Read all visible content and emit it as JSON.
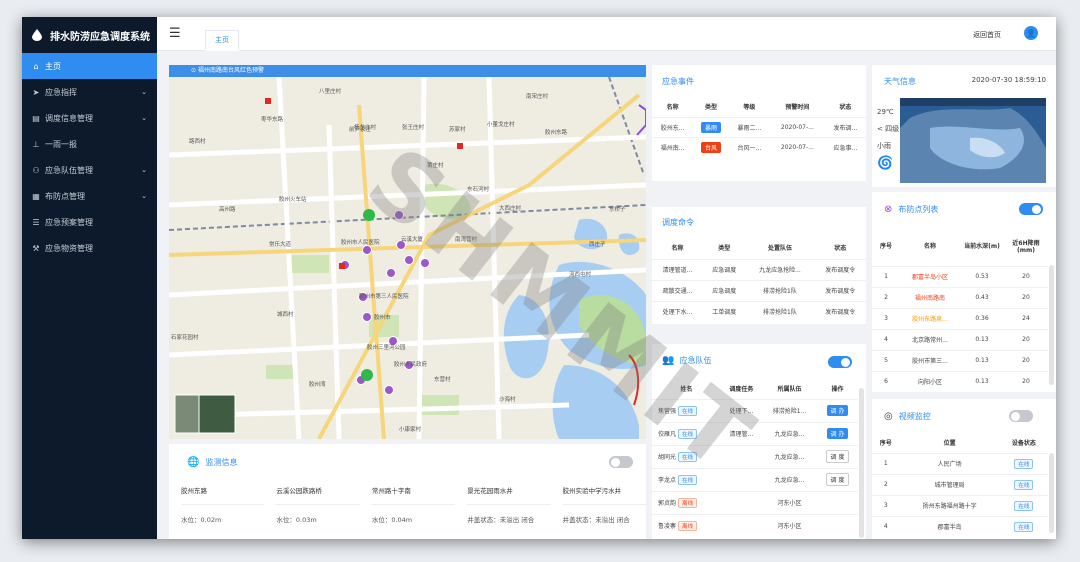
{
  "app_title": "排水防涝应急调度系统",
  "sidebar": {
    "items": [
      {
        "label": "主页",
        "icon": "home-icon",
        "active": true
      },
      {
        "label": "应急指挥",
        "icon": "send-icon",
        "expandable": true
      },
      {
        "label": "调度信息管理",
        "icon": "document-icon",
        "expandable": true
      },
      {
        "label": "一雨一报",
        "icon": "upload-icon"
      },
      {
        "label": "应急队伍管理",
        "icon": "team-icon",
        "expandable": true
      },
      {
        "label": "布防点管理",
        "icon": "grid-icon",
        "expandable": true
      },
      {
        "label": "应急预案管理",
        "icon": "list-icon"
      },
      {
        "label": "应急物资管理",
        "icon": "wrench-icon"
      }
    ]
  },
  "topbar": {
    "tab": "主页",
    "back_home": "返回首页"
  },
  "map": {
    "banner": "福州南路南台风红色预警",
    "labels": [
      "八里庄村",
      "枣华东路",
      "南宋庄村",
      "前尹家庄",
      "苏家村",
      "张王庄村",
      "小董戈庄村",
      "杨戈庄村",
      "胶州东路",
      "莆庄村",
      "东石河村",
      "胶州火车站",
      "高州路",
      "东桥子",
      "路西村",
      "大西庄村",
      "西庄子",
      "常乐大道",
      "胶州市人民医院",
      "云溪大厦",
      "南湾营村",
      "胶州市",
      "城西村",
      "胶州市第三人民医院",
      "石家花园村",
      "胶州三里河公园",
      "胶州湾",
      "小康家村",
      "胶州人民政府",
      "沙海村",
      "东营村",
      "河西屯村"
    ]
  },
  "monitor": {
    "title": "监测信息",
    "columns": [
      "胶州东路",
      "云溪公园跌路桥",
      "常州路十字南",
      "景光花园雨水井",
      "胶州实验中学污水井"
    ],
    "values": [
      "水位：0.02m",
      "水位：0.03m",
      "水位：0.04m",
      "井盖状态：未溢出 闭合",
      "井盖状态：未溢出 闭合"
    ]
  },
  "events": {
    "title": "应急事件",
    "headers": [
      "名称",
      "类型",
      "等级",
      "预警时间",
      "状态"
    ],
    "rows": [
      {
        "name": "胶州东...",
        "type": "暴雨",
        "type_color": "#2f8cf0",
        "level": "暴雨二...",
        "time": "2020-07-...",
        "status": "发布调..."
      },
      {
        "name": "福州南...",
        "type": "台风",
        "type_color": "#ed4014",
        "level": "台风一...",
        "time": "2020-07-...",
        "status": "应急事..."
      }
    ]
  },
  "commands": {
    "title": "调度命令",
    "headers": [
      "名称",
      "类型",
      "处置队伍",
      "状态"
    ],
    "rows": [
      {
        "name": "清理管道...",
        "type": "应急调度",
        "team": "九龙应急抢险...",
        "status": "发布调度令"
      },
      {
        "name": "疏散交通...",
        "type": "应急调度",
        "team": "排涝抢险1队",
        "status": "发布调度令"
      },
      {
        "name": "处理下水...",
        "type": "工单调度",
        "team": "排涝抢险1队",
        "status": "发布调度令"
      }
    ]
  },
  "teams": {
    "title": "应急队伍",
    "headers": [
      "姓名",
      "调度任务",
      "所属队伍",
      "操作"
    ],
    "rows": [
      {
        "name": "焦营强",
        "status": "在线",
        "task": "处理下...",
        "team": "排涝抢险1...",
        "action": "调 办"
      },
      {
        "name": "佼雁凡",
        "status": "在线",
        "task": "清理管...",
        "team": "九龙应急...",
        "action": "调 办"
      },
      {
        "name": "胡同光",
        "status": "在线",
        "task": "",
        "team": "九龙应急...",
        "action": "调 度"
      },
      {
        "name": "李龙点",
        "status": "在线",
        "task": "",
        "team": "九龙应急...",
        "action": "调 度"
      },
      {
        "name": "郭贞韵",
        "status": "离线",
        "task": "",
        "team": "河东小区",
        "action": ""
      },
      {
        "name": "鲁凌寨",
        "status": "离线",
        "task": "",
        "team": "河东小区",
        "action": ""
      }
    ]
  },
  "weather": {
    "title": "天气信息",
    "datetime": "2020-07-30 18:59:10",
    "temp": "29℃",
    "wind": "< 四级",
    "condition": "小雨"
  },
  "points": {
    "title": "布防点列表",
    "headers": [
      "序号",
      "名称",
      "当前水深(m)",
      "近6H降雨(mm)"
    ],
    "rows": [
      {
        "no": "1",
        "name": "郡富半岛小区",
        "depth": "0.53",
        "rain": "20",
        "color": "#ed4014"
      },
      {
        "no": "2",
        "name": "福州南路南",
        "depth": "0.43",
        "rain": "20",
        "color": "#ed4014"
      },
      {
        "no": "3",
        "name": "胶州东路泉...",
        "depth": "0.36",
        "rain": "24",
        "color": "#ff9900"
      },
      {
        "no": "4",
        "name": "北京路常州...",
        "depth": "0.13",
        "rain": "20",
        "color": "#444"
      },
      {
        "no": "5",
        "name": "胶州市第三...",
        "depth": "0.13",
        "rain": "20",
        "color": "#444"
      },
      {
        "no": "6",
        "name": "向阳小区",
        "depth": "0.13",
        "rain": "20",
        "color": "#444"
      }
    ]
  },
  "video": {
    "title": "视频监控",
    "headers": [
      "序号",
      "位置",
      "设备状态"
    ],
    "rows": [
      {
        "no": "1",
        "loc": "人民广场",
        "status": "在线"
      },
      {
        "no": "2",
        "loc": "城市管理局",
        "status": "在线"
      },
      {
        "no": "3",
        "loc": "扬州东路福州路十字",
        "status": "在线"
      },
      {
        "no": "4",
        "loc": "郡富半岛",
        "status": "在线"
      }
    ]
  },
  "watermark": "SHMMIT",
  "colors": {
    "accent": "#2f8cf0",
    "danger": "#ed4014",
    "sidebar": "#0c1a2b"
  }
}
